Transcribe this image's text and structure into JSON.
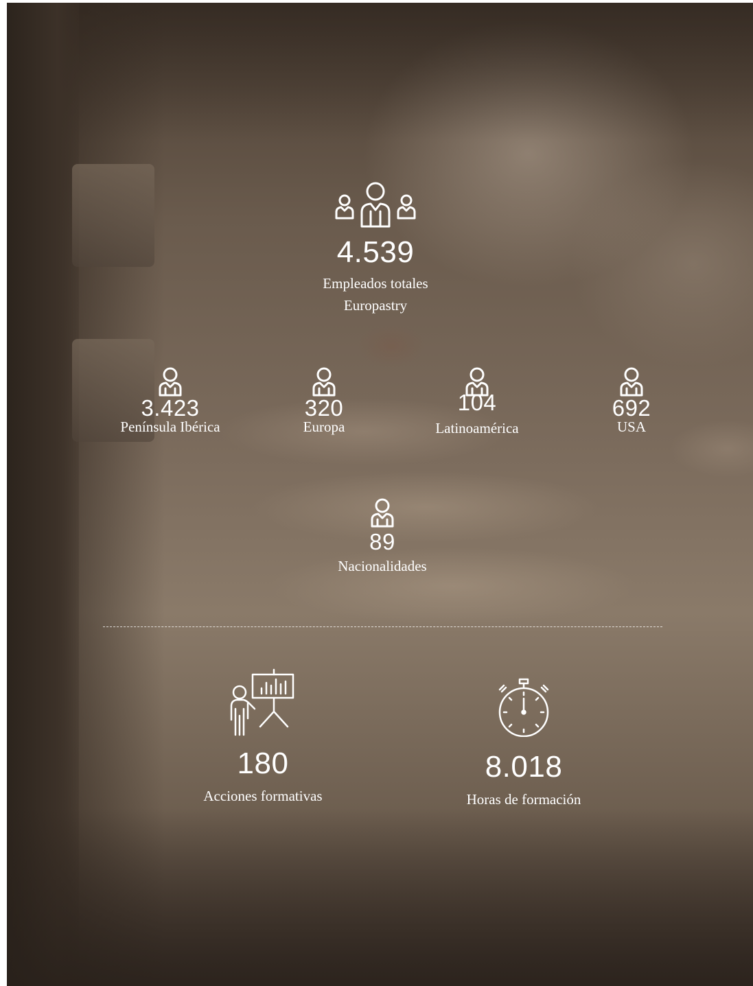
{
  "background": {
    "description_colors": [
      "#4a3d32",
      "#8a7a69"
    ]
  },
  "total_employees": {
    "value": "4.539",
    "label_line1": "Empleados totales",
    "label_line2": "Europastry",
    "icon": "group-people-icon"
  },
  "regions": [
    {
      "value": "3.423",
      "label": "Península Ibérica",
      "icon": "person-icon"
    },
    {
      "value": "320",
      "label": "Europa",
      "icon": "person-icon"
    },
    {
      "value": "104",
      "label": "Latinoamérica",
      "icon": "person-icon"
    },
    {
      "value": "692",
      "label": "USA",
      "icon": "person-icon"
    }
  ],
  "nationalities": {
    "value": "89",
    "label": "Nacionalidades",
    "icon": "person-icon"
  },
  "training_actions": {
    "value": "180",
    "label": "Acciones formativas",
    "icon": "presentation-board-icon"
  },
  "training_hours": {
    "value": "8.018",
    "label": "Horas de formación",
    "icon": "stopwatch-icon"
  }
}
